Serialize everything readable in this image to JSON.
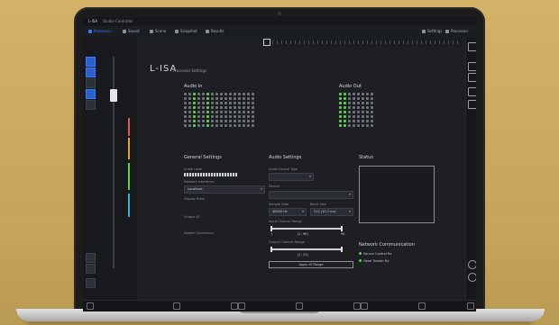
{
  "app": {
    "logo": "L-ISA",
    "window_title": "Studio Controller",
    "page_title": "Processor Settings"
  },
  "menu": {
    "items": [
      {
        "label": "Processor",
        "active": true
      },
      {
        "label": "Sound",
        "active": false
      },
      {
        "label": "Scene",
        "active": false
      },
      {
        "label": "Snapshot",
        "active": false
      },
      {
        "label": "Results",
        "active": false
      }
    ],
    "right": [
      "Settings",
      "Processor"
    ]
  },
  "sections": {
    "audio_in": "Audio In",
    "audio_out": "Audio Out",
    "general_settings": "General Settings",
    "audio_settings": "Audio Settings",
    "status": "Status",
    "network_communication": "Network Communication"
  },
  "general": {
    "audio_level_label": "Audio Level",
    "network_interfaces_label": "Network Interfaces",
    "network_interface_value": "Localhost",
    "display_ratio_label": "Display Ratio",
    "unique_id_label": "Unique ID",
    "master_connection_label": "Master Connection"
  },
  "audio": {
    "device_type_label": "Audio Device Type",
    "device_label": "Device",
    "sample_rate_label": "Sample Rate",
    "sample_rate_value": "48000 Hz",
    "block_size_label": "Block Size",
    "block_size_value": "512 (10.7 ms)",
    "input_range_label": "Input Channel Range",
    "input_range_value": "[1, 96]",
    "input_range_min": "1",
    "input_range_max": "96",
    "output_range_label": "Output Channel Range",
    "output_range_value": "[1, 13]",
    "apply_button": "Apply IO Range"
  },
  "network": {
    "items": [
      "Source Control Rx",
      "Head Tracker Rx"
    ]
  },
  "colors": {
    "accent": "#3a7bff",
    "active_green": "#5fcf4f",
    "laptop_bg": "#c9a95c"
  }
}
